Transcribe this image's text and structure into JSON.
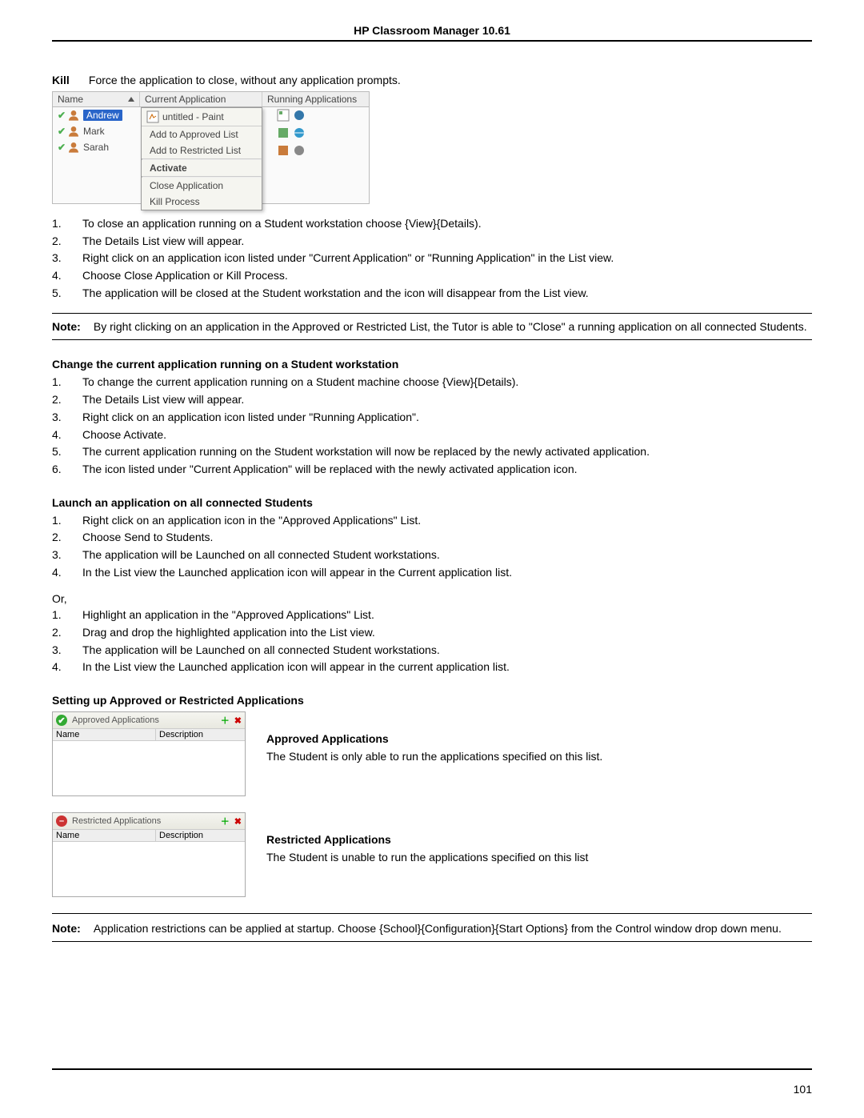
{
  "doc_header": "HP Classroom Manager 10.61",
  "kill": {
    "label": "Kill",
    "text": "Force the application to close, without any application prompts."
  },
  "shot1": {
    "columns": {
      "name": "Name",
      "current": "Current Application",
      "running": "Running Applications"
    },
    "students": [
      "Andrew",
      "Mark",
      "Sarah"
    ],
    "ctx_title": "untitled - Paint",
    "ctx_items": {
      "approved": "Add to Approved List",
      "restricted": "Add to Restricted List",
      "activate": "Activate",
      "close": "Close Application",
      "kill": "Kill Process"
    }
  },
  "list1": [
    "To close an application running on a Student workstation choose {View}{Details).",
    "The Details List view will appear.",
    "Right click on an application icon listed under \"Current Application\" or \"Running Application\" in the List view.",
    "Choose Close Application or Kill Process.",
    "The application will be closed at the Student workstation and the icon will disappear from the List view."
  ],
  "note1": {
    "label": "Note:",
    "text": "By right clicking on an application in the Approved or Restricted List, the Tutor is able to \"Close\" a running application on all connected Students."
  },
  "sec2_head": "Change the current application running on a Student workstation",
  "list2": [
    "To change the current application running on a Student machine choose {View}{Details).",
    "The Details List view will appear.",
    "Right click on an application icon listed under \"Running Application\".",
    "Choose Activate.",
    "The current application running on the Student workstation will now be replaced by the newly activated application.",
    "The icon listed under \"Current Application\" will be replaced with the newly activated application icon."
  ],
  "sec3_head": "Launch an application on all connected Students",
  "list3a": [
    "Right click on an application icon in the \"Approved Applications\" List.",
    "Choose Send to Students.",
    "The application will be Launched on all connected Student workstations.",
    "In the List view the Launched application icon will appear in the Current application list."
  ],
  "or_text": "Or,",
  "list3b": [
    "Highlight an application in the \"Approved Applications\" List.",
    "Drag and drop the highlighted application into the List view.",
    "The application will be Launched on all connected Student workstations.",
    "In the List view the Launched application icon will appear in the current application list."
  ],
  "sec4_head": "Setting up Approved or Restricted Applications",
  "approved_box": {
    "title": "Approved Applications",
    "col1": "Name",
    "col2": "Description"
  },
  "approved_side": {
    "head": "Approved Applications",
    "text": "The Student is only able to run the applications specified on this list."
  },
  "restricted_box": {
    "title": "Restricted Applications",
    "col1": "Name",
    "col2": "Description"
  },
  "restricted_side": {
    "head": "Restricted Applications",
    "text": "The Student is unable to run the applications specified on this list"
  },
  "note2": {
    "label": "Note:",
    "text": "Application restrictions can be applied at startup. Choose {School}{Configuration}{Start Options} from the Control window drop down menu."
  },
  "page_number": "101"
}
